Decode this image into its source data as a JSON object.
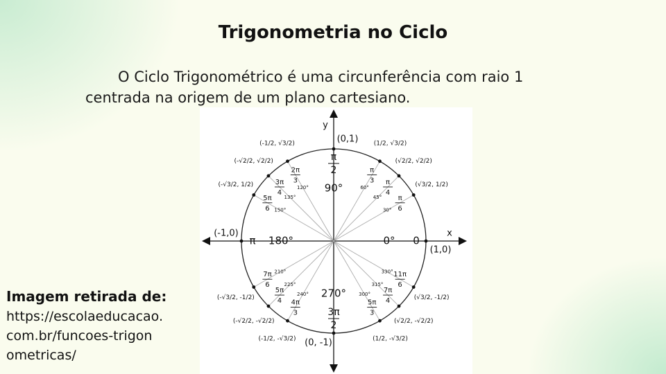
{
  "slide": {
    "title": "Trigonometria no Ciclo",
    "intro_line1": "O Ciclo Trigonométrico é uma circunferência com raio 1",
    "intro_line2": "centrada na origem de um plano cartesiano.",
    "source_heading": "Imagem retirada de:",
    "source_url_lines": [
      "https://escolaeducacao.",
      "com.br/funcoes-trigon",
      "ometricas/"
    ]
  },
  "circle": {
    "axis_x_label": "x",
    "axis_y_label": "y",
    "points": [
      {
        "deg": 0,
        "deg_label": "0°",
        "rad_label": "0",
        "coord": "(1,0)"
      },
      {
        "deg": 30,
        "deg_label": "30°",
        "rad_num": "π",
        "rad_den": "6",
        "coord": "(√3/2, 1/2)"
      },
      {
        "deg": 45,
        "deg_label": "45°",
        "rad_num": "π",
        "rad_den": "4",
        "coord": "(√2/2, √2/2)"
      },
      {
        "deg": 60,
        "deg_label": "60°",
        "rad_num": "π",
        "rad_den": "3",
        "coord": "(1/2, √3/2)"
      },
      {
        "deg": 90,
        "deg_label": "90°",
        "rad_num": "π",
        "rad_den": "2",
        "coord": "(0,1)"
      },
      {
        "deg": 120,
        "deg_label": "120°",
        "rad_num": "2π",
        "rad_den": "3",
        "coord": "(-1/2, √3/2)"
      },
      {
        "deg": 135,
        "deg_label": "135°",
        "rad_num": "3π",
        "rad_den": "4",
        "coord": "(-√2/2, √2/2)"
      },
      {
        "deg": 150,
        "deg_label": "150°",
        "rad_num": "5π",
        "rad_den": "6",
        "coord": "(-√3/2, 1/2)"
      },
      {
        "deg": 180,
        "deg_label": "180°",
        "rad_label": "π",
        "coord": "(-1,0)"
      },
      {
        "deg": 210,
        "deg_label": "210°",
        "rad_num": "7π",
        "rad_den": "6",
        "coord": "(-√3/2, -1/2)"
      },
      {
        "deg": 225,
        "deg_label": "225°",
        "rad_num": "5π",
        "rad_den": "4",
        "coord": "(-√2/2, -√2/2)"
      },
      {
        "deg": 240,
        "deg_label": "240°",
        "rad_num": "4π",
        "rad_den": "3",
        "coord": "(-1/2, -√3/2)"
      },
      {
        "deg": 270,
        "deg_label": "270°",
        "rad_num": "3π",
        "rad_den": "2",
        "coord": "(0, -1)"
      },
      {
        "deg": 300,
        "deg_label": "300°",
        "rad_num": "5π",
        "rad_den": "3",
        "coord": "(1/2, -√3/2)"
      },
      {
        "deg": 315,
        "deg_label": "315°",
        "rad_num": "7π",
        "rad_den": "4",
        "coord": "(√2/2, -√2/2)"
      },
      {
        "deg": 330,
        "deg_label": "330°",
        "rad_num": "11π",
        "rad_den": "6",
        "coord": "(√3/2, -1/2)"
      }
    ]
  }
}
